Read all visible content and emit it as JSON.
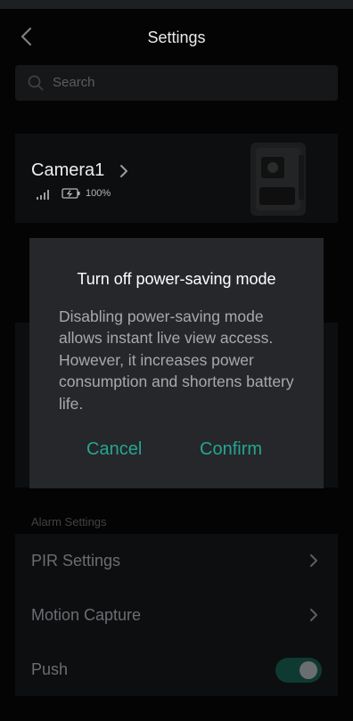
{
  "header": {
    "title": "Settings"
  },
  "search": {
    "placeholder": "Search"
  },
  "camera": {
    "name": "Camera1",
    "battery": "100%"
  },
  "alarm_section": {
    "label": "Alarm Settings",
    "items": [
      {
        "label": "PIR Settings"
      },
      {
        "label": "Motion Capture"
      },
      {
        "label": "Push",
        "toggle_on": true
      }
    ]
  },
  "dialog": {
    "title": "Turn off power-saving mode",
    "body": "Disabling power-saving mode allows instant live view access. However, it increases power consumption and shortens battery life.",
    "cancel_label": "Cancel",
    "confirm_label": "Confirm"
  },
  "colors": {
    "accent": "#25a68f",
    "dialog_bg": "#25272b",
    "page_bg": "#040404"
  }
}
